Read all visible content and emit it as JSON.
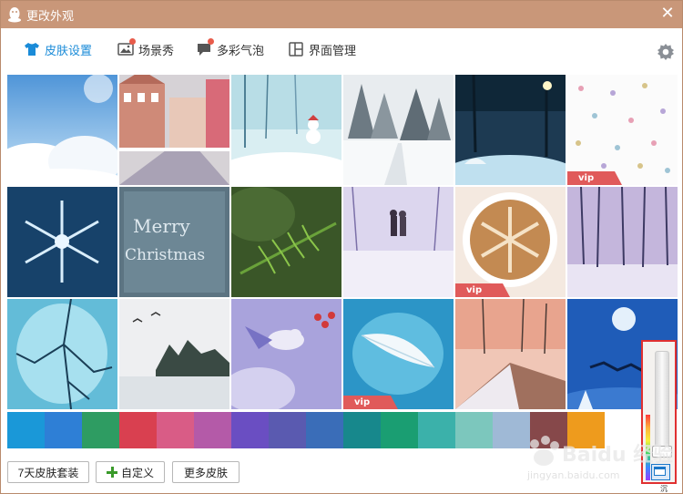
{
  "window": {
    "title": "更改外观",
    "close": "✕"
  },
  "tabs": [
    {
      "label": "皮肤设置",
      "icon": "tshirt-icon",
      "active": true,
      "badge": false
    },
    {
      "label": "场景秀",
      "icon": "picture-icon",
      "active": false,
      "badge": true
    },
    {
      "label": "多彩气泡",
      "icon": "chat-bubble-icon",
      "active": false,
      "badge": true
    },
    {
      "label": "界面管理",
      "icon": "layout-icon",
      "active": false,
      "badge": false
    }
  ],
  "skins": [
    {
      "name": "sky-clouds",
      "vip": false
    },
    {
      "name": "winter-town-street",
      "vip": false
    },
    {
      "name": "snowman-forest",
      "vip": false
    },
    {
      "name": "snowy-trees-road",
      "vip": false
    },
    {
      "name": "night-umbrella-lamp",
      "vip": false
    },
    {
      "name": "snowflake-pattern",
      "vip": true
    },
    {
      "name": "blue-snowflake",
      "vip": false
    },
    {
      "name": "merry-christmas-frost",
      "vip": false
    },
    {
      "name": "pine-branch",
      "vip": false
    },
    {
      "name": "couple-snow-walk",
      "vip": false
    },
    {
      "name": "latte-snowflake",
      "vip": true
    },
    {
      "name": "purple-forest",
      "vip": false
    },
    {
      "name": "blue-branches",
      "vip": false
    },
    {
      "name": "lake-birds-winter",
      "vip": false
    },
    {
      "name": "bird-berries",
      "vip": false
    },
    {
      "name": "white-feather",
      "vip": true
    },
    {
      "name": "boardwalk-trees",
      "vip": false
    },
    {
      "name": "moon-reindeer",
      "vip": false
    }
  ],
  "vip_label": "vip",
  "colors": [
    "#1a98d8",
    "#2e7fd6",
    "#2e9c62",
    "#d94050",
    "#d95c86",
    "#b45aa8",
    "#6a4ec2",
    "#5a5ab0",
    "#3a6db8",
    "#17888c",
    "#1a9e72",
    "#3bb1aa",
    "#7cc7bd",
    "#9fb9d6",
    "#86484a",
    "#ee9b1d"
  ],
  "bottom": {
    "trial_label": "7天皮肤套装",
    "custom_label": "自定义",
    "more_label": "更多皮肤"
  },
  "watermark": {
    "brand": "Baidu 经验",
    "url": "jingyan.baidu.com"
  },
  "corner_text": "沉"
}
